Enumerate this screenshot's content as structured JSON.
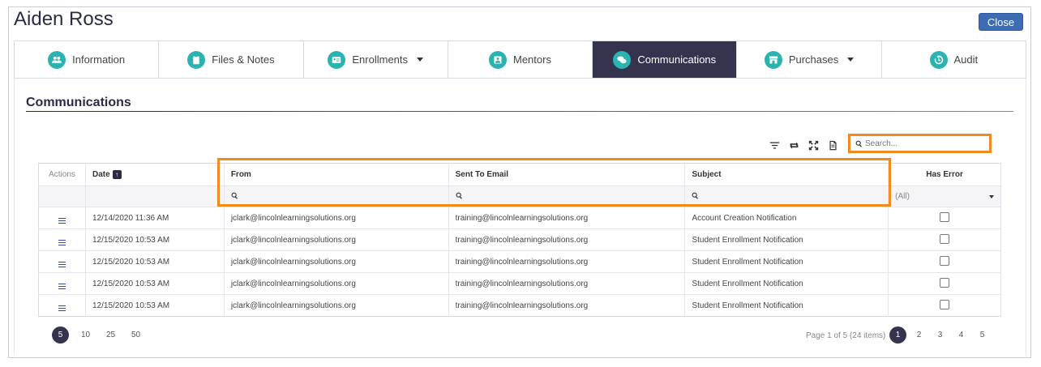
{
  "header": {
    "title": "Aiden Ross",
    "close_label": "Close"
  },
  "tabs": [
    {
      "label": "Information",
      "icon": "users-icon",
      "dropdown": false,
      "active": false
    },
    {
      "label": "Files & Notes",
      "icon": "clipboard-icon",
      "dropdown": false,
      "active": false
    },
    {
      "label": "Enrollments",
      "icon": "id-card-icon",
      "dropdown": true,
      "active": false
    },
    {
      "label": "Mentors",
      "icon": "mentor-icon",
      "dropdown": false,
      "active": false
    },
    {
      "label": "Communications",
      "icon": "chat-icon",
      "dropdown": false,
      "active": true
    },
    {
      "label": "Purchases",
      "icon": "store-icon",
      "dropdown": true,
      "active": false
    },
    {
      "label": "Audit",
      "icon": "history-icon",
      "dropdown": false,
      "active": false
    }
  ],
  "section": {
    "title": "Communications"
  },
  "search": {
    "placeholder": "Search..."
  },
  "grid": {
    "columns": {
      "actions": "Actions",
      "date": "Date",
      "from": "From",
      "sent_to": "Sent To Email",
      "subject": "Subject",
      "has_error": "Has Error"
    },
    "sort_indicator": "↑",
    "has_error_filter": "(All)",
    "rows": [
      {
        "date": "12/14/2020 11:36 AM",
        "from": "jclark@lincolnlearningsolutions.org",
        "sent_to": "training@lincolnlearningsolutions.org",
        "subject": "Account Creation Notification",
        "has_error": false
      },
      {
        "date": "12/15/2020 10:53 AM",
        "from": "jclark@lincolnlearningsolutions.org",
        "sent_to": "training@lincolnlearningsolutions.org",
        "subject": "Student Enrollment Notification",
        "has_error": false
      },
      {
        "date": "12/15/2020 10:53 AM",
        "from": "jclark@lincolnlearningsolutions.org",
        "sent_to": "training@lincolnlearningsolutions.org",
        "subject": "Student Enrollment Notification",
        "has_error": false
      },
      {
        "date": "12/15/2020 10:53 AM",
        "from": "jclark@lincolnlearningsolutions.org",
        "sent_to": "training@lincolnlearningsolutions.org",
        "subject": "Student Enrollment Notification",
        "has_error": false
      },
      {
        "date": "12/15/2020 10:53 AM",
        "from": "jclark@lincolnlearningsolutions.org",
        "sent_to": "training@lincolnlearningsolutions.org",
        "subject": "Student Enrollment Notification",
        "has_error": false
      }
    ]
  },
  "pager": {
    "sizes": [
      "5",
      "10",
      "25",
      "50"
    ],
    "active_size": "5",
    "info": "Page 1 of 5 (24 items)",
    "pages": [
      "1",
      "2",
      "3",
      "4",
      "5"
    ],
    "active_page": "1"
  },
  "colors": {
    "accent": "#2ab3b0",
    "active_tab": "#34344f",
    "highlight": "#f08c1e",
    "close_button": "#3d6cb3"
  }
}
